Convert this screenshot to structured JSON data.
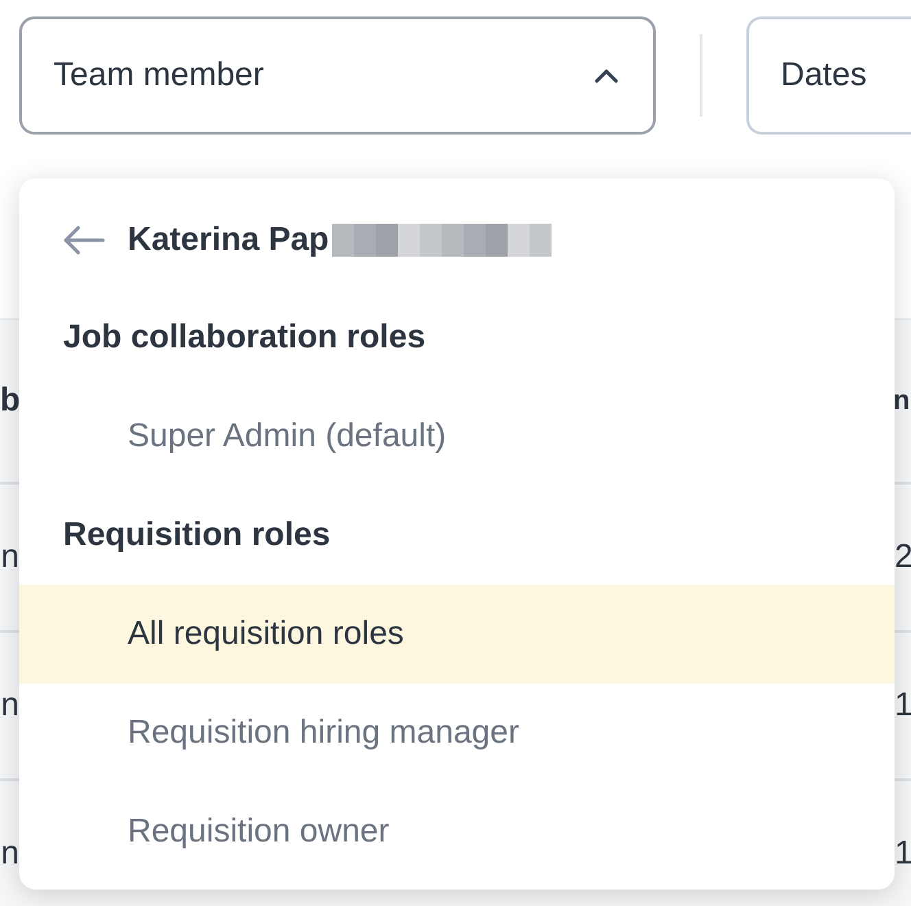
{
  "filters": [
    {
      "kind": "dropdown",
      "label": "Team member",
      "expanded": true
    },
    {
      "kind": "button",
      "label": "Dates"
    }
  ],
  "table": {
    "columns": [
      {
        "column_1": "b",
        "column_2": "n"
      }
    ],
    "rows": [
      {
        "column_1": "n",
        "column_2": "2"
      },
      {
        "column_1": "n",
        "column_2": "1"
      },
      {
        "column_1": "n",
        "column_2": "1"
      }
    ]
  },
  "menu": {
    "person": "Katerina Pap",
    "sections": [
      {
        "title": "Job collaboration roles",
        "items": [
          {
            "label": "Super Admin (default)",
            "selected": false
          }
        ]
      },
      {
        "title": "Requisition roles",
        "items": [
          {
            "label": "All requisition roles",
            "selected": true
          },
          {
            "label": "Requisition hiring manager",
            "selected": false
          },
          {
            "label": "Requisition owner",
            "selected": false
          }
        ]
      }
    ]
  }
}
